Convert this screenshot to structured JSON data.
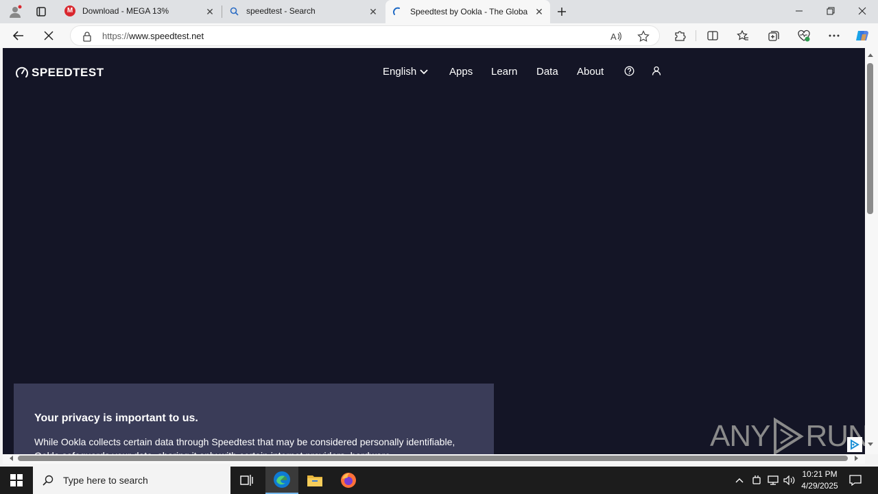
{
  "browser": {
    "tabs": [
      {
        "title": "Download - MEGA 13%",
        "icon": "mega-icon"
      },
      {
        "title": "speedtest - Search",
        "icon": "search-icon"
      },
      {
        "title": "Speedtest by Ookla - The Global",
        "icon": "loading-icon",
        "active": true
      }
    ],
    "url_prefix": "https://",
    "url_host": "www.speedtest.net"
  },
  "site": {
    "logo_text": "SPEEDTEST",
    "nav": {
      "language": "English",
      "apps": "Apps",
      "learn": "Learn",
      "data": "Data",
      "about": "About"
    },
    "privacy": {
      "title": "Your privacy is important to us.",
      "body": "While Ookla collects certain data through Speedtest that may be considered personally identifiable, Ookla safeguards your data, sharing it only with certain internet providers, hardware"
    }
  },
  "watermark": {
    "text_left": "ANY",
    "text_right": "RUN"
  },
  "taskbar": {
    "search_placeholder": "Type here to search",
    "time": "10:21 PM",
    "date": "4/29/2025"
  },
  "colors": {
    "page_bg": "#141526",
    "privacy_bg": "#3a3c58",
    "mega_red": "#d9272e",
    "edge_blue": "#0f7bd4"
  }
}
